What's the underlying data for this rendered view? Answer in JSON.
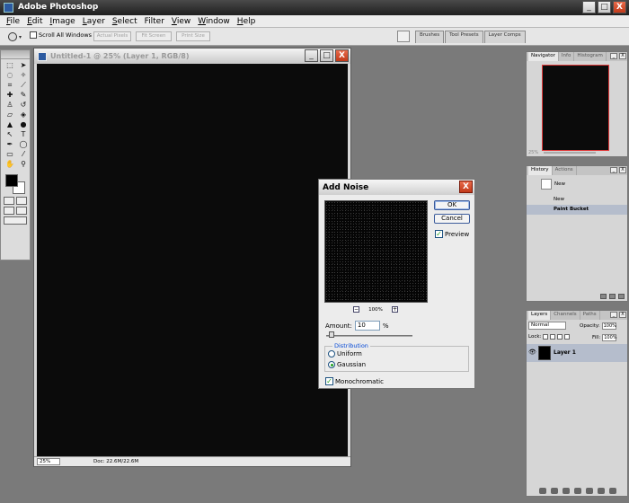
{
  "app": {
    "title": "Adobe Photoshop"
  },
  "window_controls": {
    "minimize": "_",
    "maximize": "□",
    "close": "X"
  },
  "menu": [
    "File",
    "Edit",
    "Image",
    "Layer",
    "Select",
    "Filter",
    "View",
    "Window",
    "Help"
  ],
  "options_bar": {
    "scroll_all_windows_label": "Scroll All Windows",
    "scroll_all_windows_checked": false,
    "buttons": [
      "Actual Pixels",
      "Fit Screen",
      "Print Size"
    ],
    "palette_well_tabs": [
      "Brushes",
      "Tool Presets",
      "Layer Comps"
    ]
  },
  "document": {
    "title": "Untitled-1 @ 25% (Layer 1, RGB/8)",
    "zoom": "25%",
    "doc_size": "Doc: 22.6M/22.6M",
    "canvas_color": "#0b0b0b"
  },
  "dialog": {
    "title": "Add Noise",
    "ok_label": "OK",
    "cancel_label": "Cancel",
    "preview_label": "Preview",
    "preview_checked": true,
    "preview_zoom": "100%",
    "zoom_out": "−",
    "zoom_in": "+",
    "amount_label": "Amount:",
    "amount_value": "10",
    "amount_unit": "%",
    "distribution_label": "Distribution",
    "uniform_label": "Uniform",
    "gaussian_label": "Gaussian",
    "selected_distribution": "Gaussian",
    "monochromatic_label": "Monochromatic",
    "monochromatic_checked": true,
    "check_glyph": "✓"
  },
  "navigator": {
    "tabs": [
      "Navigator",
      "Info",
      "Histogram"
    ],
    "zoom": "25%"
  },
  "history": {
    "tabs": [
      "History",
      "Actions"
    ],
    "snapshot": "New",
    "steps": [
      "New",
      "Paint Bucket"
    ],
    "selected_step": "Paint Bucket"
  },
  "layers": {
    "tabs": [
      "Layers",
      "Channels",
      "Paths"
    ],
    "blend_mode": "Normal",
    "opacity_label": "Opacity:",
    "opacity": "100%",
    "lock_label": "Lock:",
    "fill_label": "Fill:",
    "fill": "100%",
    "layer_name": "Layer 1",
    "eye_glyph": "👁"
  },
  "colors": {
    "workspace": "#7a7a7a",
    "foreground": "#000000",
    "background": "#ffffff",
    "selection_highlight": "#b5bdcc"
  }
}
